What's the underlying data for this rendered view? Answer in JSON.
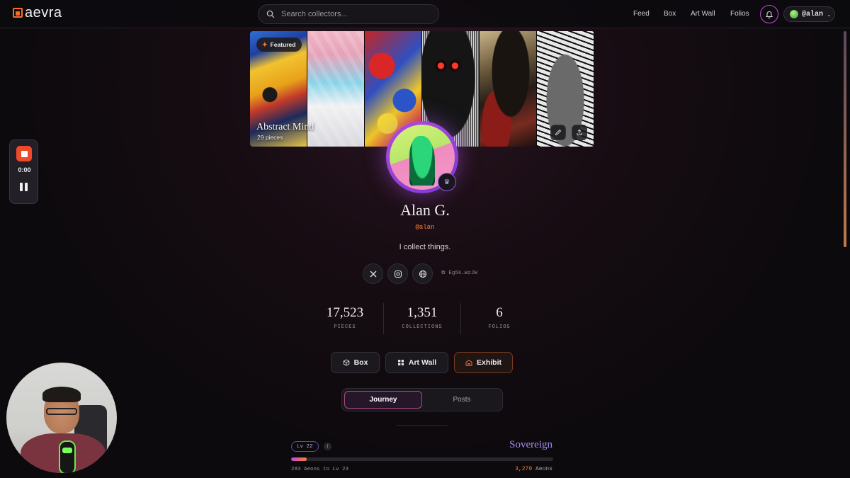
{
  "nav": {
    "logo": "aevra",
    "search_placeholder": "Search collectors...",
    "links": [
      "Feed",
      "Box",
      "Art Wall",
      "Folios"
    ],
    "user_handle": "@alan"
  },
  "banner": {
    "featured_label": "Featured",
    "folio_title": "Abstract Mind",
    "folio_count": "29 pieces"
  },
  "profile": {
    "name": "Alan G.",
    "handle": "@alan",
    "bio": "I collect things.",
    "wallet": "Eg5k…WzJW"
  },
  "stats": [
    {
      "value": "17,523",
      "label": "PIECES"
    },
    {
      "value": "1,351",
      "label": "COLLECTIONS"
    },
    {
      "value": "6",
      "label": "FOLIOS"
    }
  ],
  "actions": {
    "box": "Box",
    "art_wall": "Art Wall",
    "exhibit": "Exhibit"
  },
  "tabs": {
    "journey": "Journey",
    "posts": "Posts"
  },
  "journey": {
    "level_chip": "Lv 22",
    "tier": "Sovereign",
    "progress_fraction": 0.06,
    "to_next": "283 Aeons to Lv 23",
    "aeons_value": "3,270",
    "aeons_unit": "Aeons"
  },
  "recorder": {
    "time": "0:00"
  },
  "colors": {
    "accent_orange": "#ff7a3a",
    "accent_purple": "#c04ad6",
    "tier_purple": "#a98af0"
  }
}
